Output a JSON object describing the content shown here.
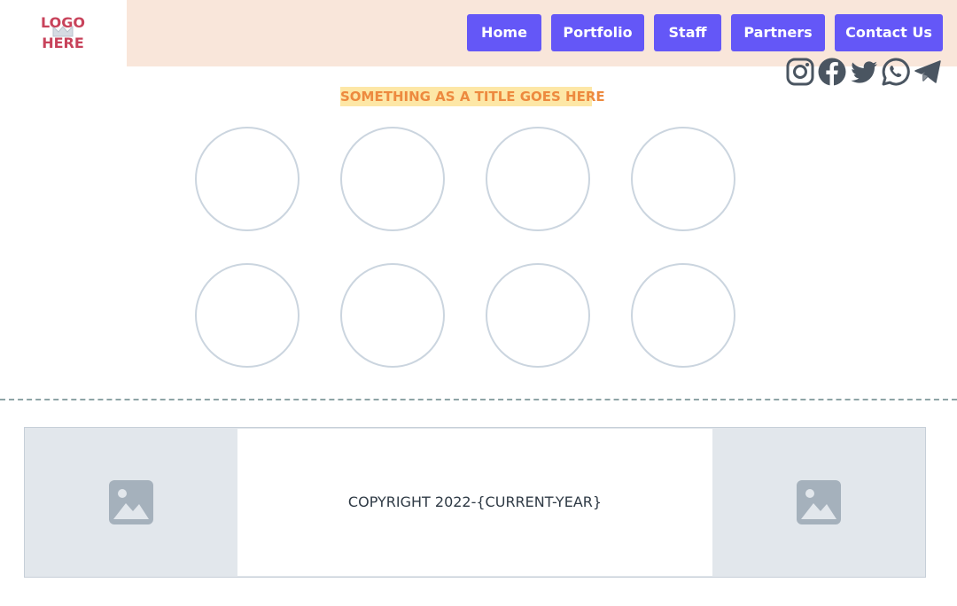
{
  "logo": {
    "line1": "LOGO",
    "line2": "HERE"
  },
  "nav": {
    "items": [
      {
        "label": "Home"
      },
      {
        "label": "Portfolio"
      },
      {
        "label": "Staff"
      },
      {
        "label": "Partners"
      },
      {
        "label": "Contact Us"
      }
    ]
  },
  "social": [
    "instagram-icon",
    "facebook-icon",
    "twitter-icon",
    "whatsapp-icon",
    "telegram-icon"
  ],
  "main": {
    "title": "SOMETHING AS A TITLE GOES HERE"
  },
  "footer": {
    "copyright": "COPYRIGHT 2022-{CURRENT-YEAR}"
  },
  "colors": {
    "nav_button": "#6457f7",
    "header_band": "#f9e6da",
    "title_text": "#ed8a3f",
    "title_highlight": "#fde7a6",
    "logo": "#c8435b"
  }
}
